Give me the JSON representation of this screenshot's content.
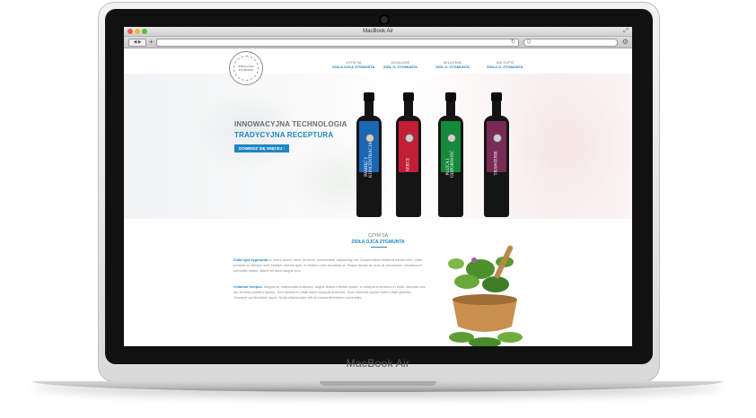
{
  "device": {
    "brand_label": "MacBook Air"
  },
  "browser": {
    "window_title": "MacBook Air",
    "url": "",
    "search_placeholder": ""
  },
  "site": {
    "logo_text": "ZIOŁA OJCA ZYGMUNTA",
    "nav": [
      {
        "line1": "CZYM SĄ",
        "line2": "ZIOŁA OJCA ZYGMUNTA"
      },
      {
        "line1": "DZIAŁANIE",
        "line2": "ZIÓŁ O. ZYGMUNTA"
      },
      {
        "line1": "SKŁADNIKI",
        "line2": "ZIÓŁ O. ZYGMUNTA"
      },
      {
        "line1": "JAK KUPIĆ",
        "line2": "ZIOŁA O. ZYGMUNTA"
      }
    ],
    "hero": {
      "headline1": "INNOWACYJNA TECHNOLOGIA",
      "headline2": "TRADYCYJNA RECEPTURA",
      "cta_label": "DOWIEDZ SIĘ WIĘCEJ ›"
    },
    "bottles": [
      {
        "name": "PAMIĘĆ I KONCENTRACJA",
        "color": "#1b67b4"
      },
      {
        "name": "SERCE",
        "color": "#c21f36"
      },
      {
        "name": "PŁUCA I ODPORNOŚĆ",
        "color": "#148a3a"
      },
      {
        "name": "TRAWIENIE",
        "color": "#7a2a54"
      }
    ],
    "section": {
      "small": "CZYM SĄ",
      "title": "ZIOŁA OJCA ZYGMUNTA",
      "p1_strong": "Zioła ojca zygmunta",
      "p1": " to lorem ipsum dolor sit amet, consectetur adipiscing elit. Suspendisse eleifend metus nibh, vitae pretium ex tempor sed. Nullam viverra quis, et finibus nunc faucibus ut. Fusce iaculis ac arcu at accumsan. Vivamus id convallis metus. Morbi sit amet augue orci.",
      "p2_strong": "Vivamus tempus.",
      "p2": " Magna ac malesuada euismod, augue lectus efficitur quam, a volutpat erat tellus in enim. Aenean nec leo at nulla porttitor lacinia. Sed lacinia ex vitae diam volutpat euismod. Duis vehicula auctor lorem vitae gravida. Vivamus vel tincidunt turpis. Nulla ullamcorper elit id massa bibendum commodo."
    }
  },
  "colors": {
    "accent": "#1f86c4",
    "close": "#ee5b52",
    "minimize": "#f2b52f",
    "zoom": "#57bf3f"
  }
}
